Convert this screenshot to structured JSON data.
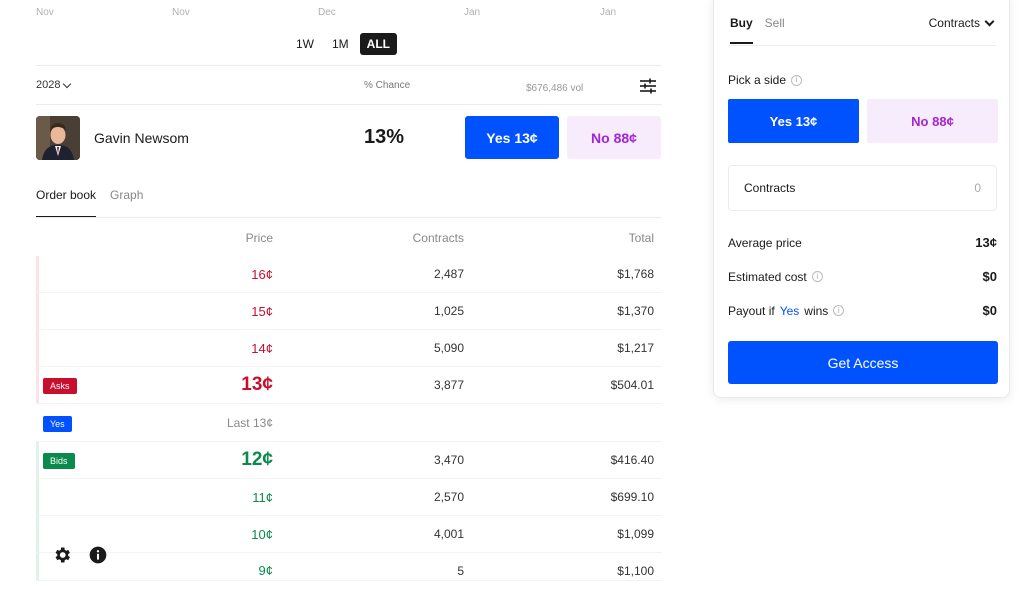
{
  "chart_axis": {
    "labels": [
      "Nov",
      "Nov",
      "Dec",
      "Jan",
      "Jan"
    ]
  },
  "range": {
    "w1": "1W",
    "m1": "1M",
    "all": "ALL"
  },
  "market": {
    "year": "2028",
    "chance_header": "% Chance",
    "volume": "$676,486 vol"
  },
  "candidate": {
    "name": "Gavin Newsom",
    "chance": "13%",
    "yes_label": "Yes 13¢",
    "no_label": "No 88¢"
  },
  "tabs": {
    "order_book": "Order book",
    "graph": "Graph"
  },
  "orderbook": {
    "headers": {
      "price": "Price",
      "contracts": "Contracts",
      "total": "Total"
    },
    "asks": [
      {
        "price": "16¢",
        "contracts": "2,487",
        "total": "$1,768"
      },
      {
        "price": "15¢",
        "contracts": "1,025",
        "total": "$1,370"
      },
      {
        "price": "14¢",
        "contracts": "5,090",
        "total": "$1,217"
      },
      {
        "price": "13¢",
        "contracts": "3,877",
        "total": "$504.01"
      }
    ],
    "asks_tag": "Asks",
    "yes_tag": "Yes",
    "last_label": "Last 13¢",
    "bids_tag": "Bids",
    "bids": [
      {
        "price": "12¢",
        "contracts": "3,470",
        "total": "$416.40"
      },
      {
        "price": "11¢",
        "contracts": "2,570",
        "total": "$699.10"
      },
      {
        "price": "10¢",
        "contracts": "4,001",
        "total": "$1,099"
      },
      {
        "price": "9¢",
        "contracts": "5",
        "total": "$1,100"
      }
    ]
  },
  "panel": {
    "buy": "Buy",
    "sell": "Sell",
    "unit_select": "Contracts",
    "pick_side": "Pick a side",
    "yes_label": "Yes 13¢",
    "no_label": "No 88¢",
    "contracts_label": "Contracts",
    "contracts_value": "0",
    "avg_price_label": "Average price",
    "avg_price_value": "13¢",
    "est_cost_label": "Estimated cost",
    "est_cost_value": "$0",
    "payout_prefix": "Payout if",
    "payout_yes": "Yes",
    "payout_suffix": "wins",
    "payout_value": "$0",
    "cta": "Get Access"
  },
  "colors": {
    "yes_blue": "#0052ff",
    "no_purple": "#a524d6",
    "ask_red": "#c8102e",
    "bid_green": "#0a8a4c"
  }
}
